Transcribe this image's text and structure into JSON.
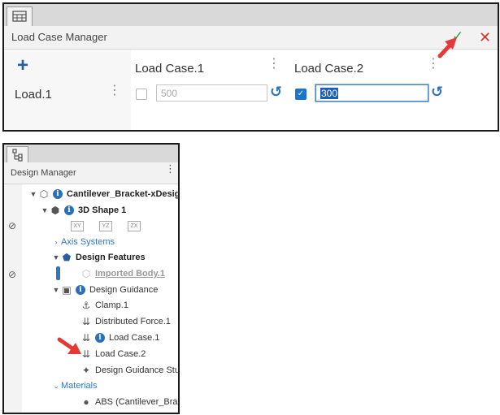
{
  "load_case_manager": {
    "title": "Load Case Manager",
    "ok_icon": "checkmark-icon",
    "close_icon": "close-icon",
    "add_label": "+",
    "columns": [
      {
        "label": "Load Case.1"
      },
      {
        "label": "Load Case.2"
      }
    ],
    "rows": [
      {
        "label": "Load.1",
        "cells": [
          {
            "checked": false,
            "value": "500"
          },
          {
            "checked": true,
            "value": "300"
          }
        ]
      }
    ]
  },
  "design_manager": {
    "title": "Design Manager",
    "tree": {
      "root": "Cantilever_Bracket-xDesign",
      "shape": "3D Shape 1",
      "axes": [
        "XY",
        "YZ",
        "ZX"
      ],
      "axis_systems": "Axis Systems",
      "design_features": "Design Features",
      "imported_body": "Imported Body.1",
      "design_guidance": "Design Guidance",
      "clamp": "Clamp.1",
      "distributed_force": "Distributed Force.1",
      "load_case_1": "Load Case.1",
      "load_case_2": "Load Case.2",
      "study": "Design Guidance Stu...",
      "materials": "Materials",
      "material": "ABS (Cantilever_Brac..."
    }
  },
  "colors": {
    "accent_blue": "#1f5fa8",
    "ok_green": "#2c9b43",
    "close_red": "#d9322a",
    "annotation_red": "#e53935"
  }
}
